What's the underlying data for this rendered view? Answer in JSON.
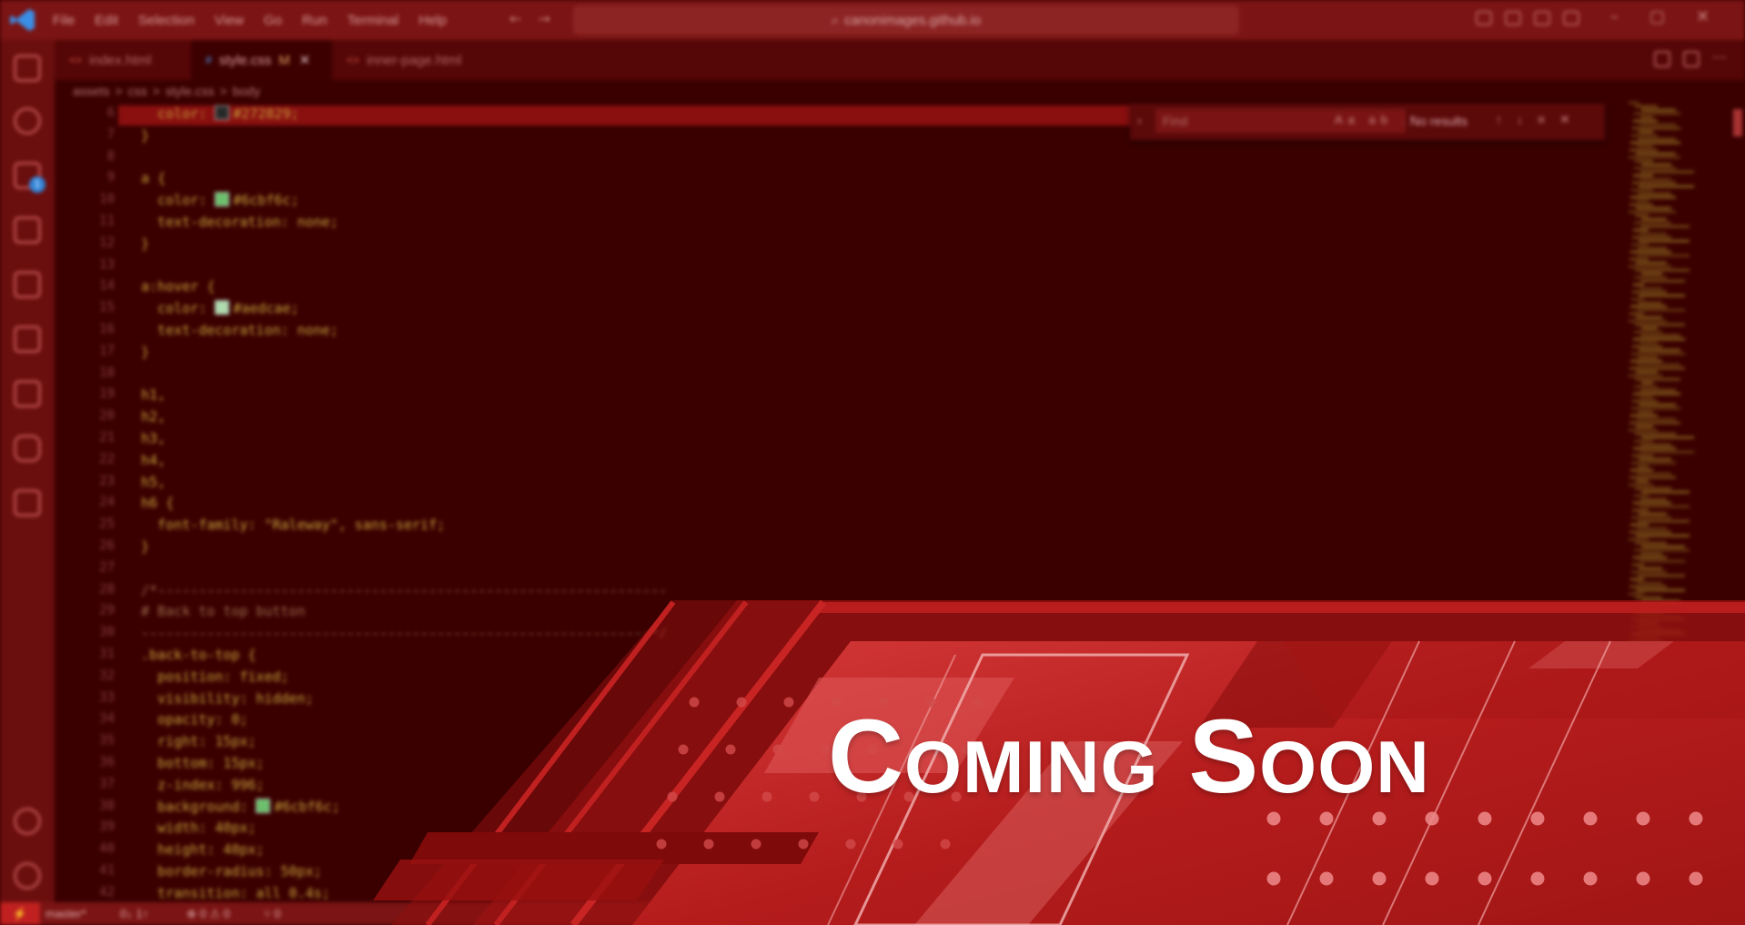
{
  "titlebar": {
    "menu": [
      "File",
      "Edit",
      "Selection",
      "View",
      "Go",
      "Run",
      "Terminal",
      "Help"
    ],
    "search": "canonimages.github.io"
  },
  "activitybar": {
    "icons": [
      "explorer-icon",
      "search-icon",
      "source-control-icon",
      "run-debug-icon",
      "extensions-icon",
      "remote-explorer-icon",
      "testing-icon",
      "python-icon",
      "chat-icon",
      "account-icon",
      "settings-gear-icon"
    ],
    "scm_badge": "1"
  },
  "tabs": [
    {
      "label": "index.html",
      "type": "html"
    },
    {
      "label": "style.css",
      "type": "css",
      "modified": "M",
      "active": true
    },
    {
      "label": "inner-page.html",
      "type": "html"
    }
  ],
  "breadcrumb": {
    "items": [
      "assets",
      ">",
      "css",
      ">",
      "style.css",
      ">",
      "body"
    ]
  },
  "code": {
    "lines": [
      {
        "n": "6",
        "text": "  color: #272829;"
      },
      {
        "n": "7",
        "text": "}"
      },
      {
        "n": "8",
        "text": ""
      },
      {
        "n": "9",
        "text": "a {"
      },
      {
        "n": "10",
        "text": "  color: #6cbf6c;"
      },
      {
        "n": "11",
        "text": "  text-decoration: none;"
      },
      {
        "n": "12",
        "text": "}"
      },
      {
        "n": "13",
        "text": ""
      },
      {
        "n": "14",
        "text": "a:hover {"
      },
      {
        "n": "15",
        "text": "  color: #aedcae;"
      },
      {
        "n": "16",
        "text": "  text-decoration: none;"
      },
      {
        "n": "17",
        "text": "}"
      },
      {
        "n": "18",
        "text": ""
      },
      {
        "n": "19",
        "text": "h1,"
      },
      {
        "n": "20",
        "text": "h2,"
      },
      {
        "n": "21",
        "text": "h3,"
      },
      {
        "n": "22",
        "text": "h4,"
      },
      {
        "n": "23",
        "text": "h5,"
      },
      {
        "n": "24",
        "text": "h6 {"
      },
      {
        "n": "25",
        "text": "  font-family: \"Raleway\", sans-serif;"
      },
      {
        "n": "26",
        "text": "}"
      },
      {
        "n": "27",
        "text": ""
      },
      {
        "n": "28",
        "text": "/*--------------------------------------------------------------"
      },
      {
        "n": "29",
        "text": "# Back to top button"
      },
      {
        "n": "30",
        "text": "--------------------------------------------------------------*/"
      },
      {
        "n": "31",
        "text": ".back-to-top {"
      },
      {
        "n": "32",
        "text": "  position: fixed;"
      },
      {
        "n": "33",
        "text": "  visibility: hidden;"
      },
      {
        "n": "34",
        "text": "  opacity: 0;"
      },
      {
        "n": "35",
        "text": "  right: 15px;"
      },
      {
        "n": "36",
        "text": "  bottom: 15px;"
      },
      {
        "n": "37",
        "text": "  z-index: 996;"
      },
      {
        "n": "38",
        "text": "  background: #6cbf6c;"
      },
      {
        "n": "39",
        "text": "  width: 40px;"
      },
      {
        "n": "40",
        "text": "  height: 40px;"
      },
      {
        "n": "41",
        "text": "  border-radius: 50px;"
      },
      {
        "n": "42",
        "text": "  transition: all 0.4s;"
      }
    ],
    "swatches": {
      "line6": "#272829",
      "line10": "#6cbf6c",
      "line15": "#aedcae",
      "line38": "#6cbf6c"
    }
  },
  "find": {
    "placeholder": "Find",
    "options": "Aa ab .*",
    "results": "No results"
  },
  "statusbar": {
    "branch": "master*",
    "sync": "0↓ 1↑",
    "problems": "⊗ 0 ⚠ 0",
    "ports": "⑂ 0"
  },
  "banner": {
    "headline": "Coming Soon",
    "colors": {
      "primary": "#b01818",
      "dark": "#3a0000",
      "accent": "#e05050",
      "text": "#ffffff"
    }
  }
}
